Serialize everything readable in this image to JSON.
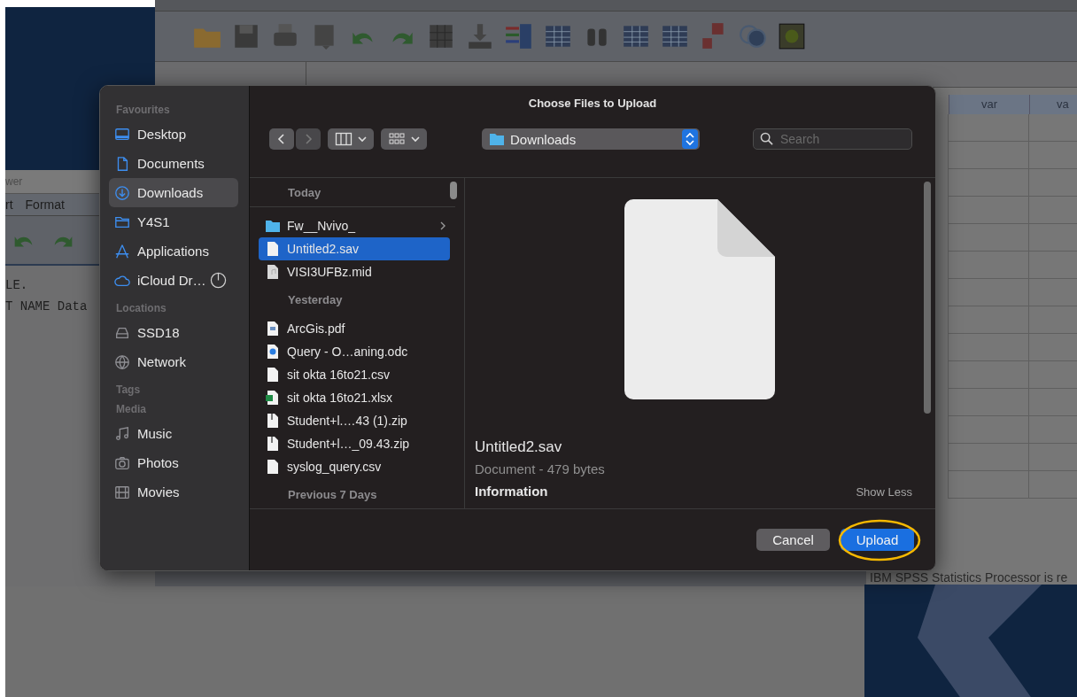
{
  "background": {
    "viewer": {
      "title": "wer",
      "menu": [
        "rt",
        "Format"
      ],
      "lines": [
        "LE.",
        "T NAME Data"
      ]
    },
    "data_editor": {
      "columns": [
        "var",
        "va"
      ],
      "status": "IBM SPSS Statistics Processor is re"
    }
  },
  "dialog": {
    "title": "Choose Files to Upload",
    "sidebar": [
      {
        "heading": "Favourites",
        "items": [
          {
            "label": "Desktop",
            "kind": "desktop",
            "selected": false,
            "syncing": false
          },
          {
            "label": "Documents",
            "kind": "document",
            "selected": false,
            "syncing": false
          },
          {
            "label": "Downloads",
            "kind": "download",
            "selected": true,
            "syncing": false
          },
          {
            "label": "Y4S1",
            "kind": "folder",
            "selected": false,
            "syncing": false
          },
          {
            "label": "Applications",
            "kind": "apps",
            "selected": false,
            "syncing": false
          },
          {
            "label": "iCloud Dr…",
            "kind": "cloud",
            "selected": false,
            "syncing": true
          }
        ]
      },
      {
        "heading": "Locations",
        "items": [
          {
            "label": "SSD18",
            "kind": "drive",
            "selected": false,
            "syncing": false
          },
          {
            "label": "Network",
            "kind": "globe",
            "selected": false,
            "syncing": false
          }
        ]
      },
      {
        "heading": "Tags"
      },
      {
        "heading": "Media",
        "items": [
          {
            "label": "Music",
            "kind": "music",
            "selected": false,
            "syncing": false
          },
          {
            "label": "Photos",
            "kind": "camera",
            "selected": false,
            "syncing": false
          },
          {
            "label": "Movies",
            "kind": "film",
            "selected": false,
            "syncing": false
          }
        ]
      }
    ],
    "nav_buttons": [
      {
        "kind": "back",
        "disabled": false
      },
      {
        "kind": "forward",
        "disabled": true
      }
    ],
    "location": "Downloads",
    "search": {
      "placeholder": "Search"
    },
    "file_groups": [
      {
        "heading": "Today",
        "files": [
          {
            "name": "Fw__Nvivo_",
            "kind": "folder",
            "selected": false
          },
          {
            "name": "Untitled2.sav",
            "kind": "doc",
            "selected": true
          },
          {
            "name": "VISI3UFBz.mid",
            "kind": "audio",
            "selected": false
          }
        ]
      },
      {
        "heading": "Yesterday",
        "files": [
          {
            "name": "ArcGis.pdf",
            "kind": "pdf",
            "selected": false
          },
          {
            "name": "Query - O…aning.odc",
            "kind": "odc",
            "selected": false
          },
          {
            "name": "sit okta 16to21.csv",
            "kind": "doc",
            "selected": false
          },
          {
            "name": "sit okta 16to21.xlsx",
            "kind": "excel",
            "selected": false
          },
          {
            "name": "Student+l.…43 (1).zip",
            "kind": "zip",
            "selected": false
          },
          {
            "name": "Student+l…_09.43.zip",
            "kind": "zip",
            "selected": false
          },
          {
            "name": "syslog_query.csv",
            "kind": "doc",
            "selected": false
          }
        ]
      },
      {
        "heading": "Previous 7 Days"
      }
    ],
    "preview": {
      "name": "Untitled2.sav",
      "meta": "Document - 479 bytes",
      "section": "Information",
      "toggle": "Show Less"
    },
    "buttons": [
      {
        "label": "Cancel",
        "kind": "secondary"
      },
      {
        "label": "Upload",
        "kind": "primary"
      }
    ]
  }
}
